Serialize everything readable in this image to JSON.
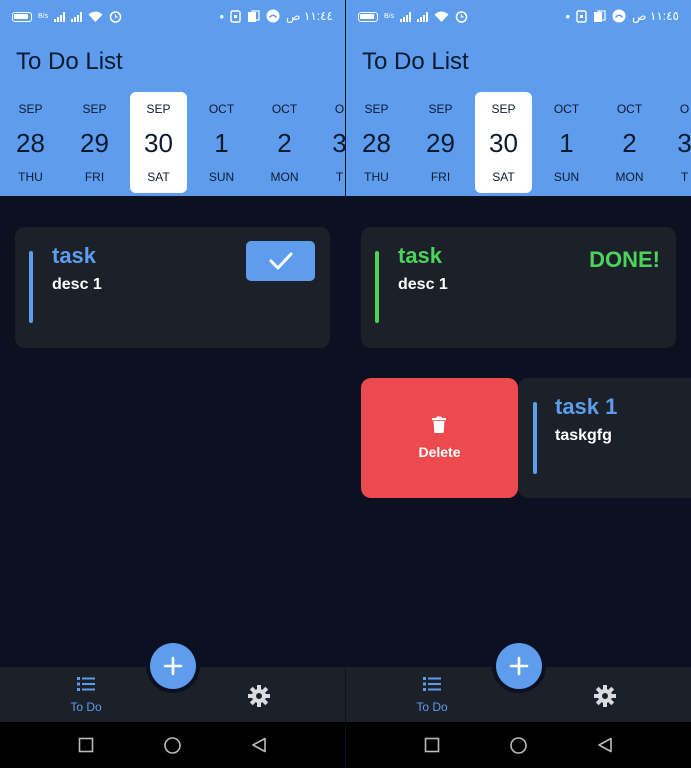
{
  "colors": {
    "header": "#5e9ced",
    "background": "#0b1120",
    "card": "#1c2129",
    "accent": "#5e9ced",
    "done": "#4cd35b",
    "delete": "#ec4a4e"
  },
  "status_bar": {
    "left": {
      "time": "١١:٤٤ ص"
    },
    "right": {
      "time": "١١:٤٥ ص"
    },
    "data_rate": "B/s",
    "icons": [
      "battery-icon",
      "signal-icon",
      "wifi-icon",
      "alarm-icon",
      "dot-icon",
      "sim-icon",
      "app-notification-icon",
      "smile-icon"
    ]
  },
  "app_title": "To Do List",
  "dates": [
    {
      "mon": "SEP",
      "num": "28",
      "dow": "THU"
    },
    {
      "mon": "SEP",
      "num": "29",
      "dow": "FRI"
    },
    {
      "mon": "SEP",
      "num": "30",
      "dow": "SAT",
      "selected": true
    },
    {
      "mon": "OCT",
      "num": "1",
      "dow": "SUN"
    },
    {
      "mon": "OCT",
      "num": "2",
      "dow": "MON"
    },
    {
      "mon": "O",
      "num": "3",
      "dow": "T"
    }
  ],
  "left_screen": {
    "task": {
      "title": "task",
      "desc": "desc 1",
      "action": "check-icon"
    }
  },
  "right_screen": {
    "done_task": {
      "title": "task",
      "desc": "desc 1",
      "status": "DONE!"
    },
    "swiped_task": {
      "title": "task 1",
      "desc": "taskgfg"
    },
    "delete_label": "Delete"
  },
  "bottom_nav": {
    "todo_label": "To Do",
    "fab_icon": "plus-icon",
    "settings_icon": "gear-icon"
  },
  "system_nav": [
    "recents-button",
    "home-button",
    "back-button"
  ]
}
